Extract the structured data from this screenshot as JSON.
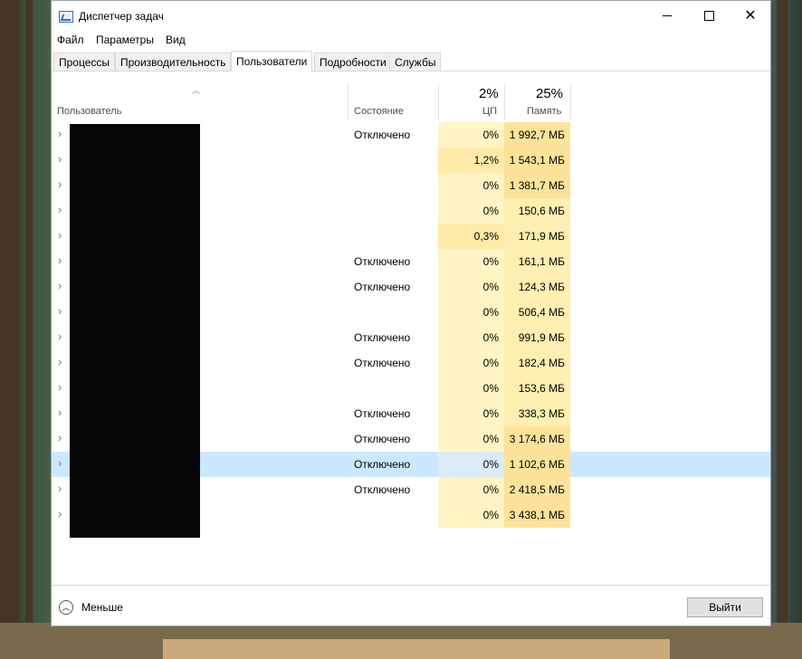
{
  "window": {
    "title": "Диспетчер задач",
    "minimize": "—",
    "maximize": "□",
    "close": "✕"
  },
  "menu": [
    "Файл",
    "Параметры",
    "Вид"
  ],
  "tabs": [
    "Процессы",
    "Производительность",
    "Пользователи",
    "Подробности",
    "Службы"
  ],
  "active_tab": "Пользователи",
  "columns": {
    "user": "Пользователь",
    "state": "Состояние",
    "cpu_total": "2%",
    "cpu": "ЦП",
    "mem_total": "25%",
    "mem": "Память"
  },
  "rows": [
    {
      "state": "Отключено",
      "cpu": "0%",
      "mem": "1 992,7 МБ"
    },
    {
      "state": "",
      "cpu": "1,2%",
      "mem": "1 543,1 МБ"
    },
    {
      "state": "",
      "cpu": "0%",
      "mem": "1 381,7 МБ"
    },
    {
      "state": "",
      "cpu": "0%",
      "mem": "150,6 МБ"
    },
    {
      "state": "",
      "cpu": "0,3%",
      "mem": "171,9 МБ"
    },
    {
      "state": "Отключено",
      "cpu": "0%",
      "mem": "161,1 МБ"
    },
    {
      "state": "Отключено",
      "cpu": "0%",
      "mem": "124,3 МБ"
    },
    {
      "state": "",
      "cpu": "0%",
      "mem": "506,4 МБ"
    },
    {
      "state": "Отключено",
      "cpu": "0%",
      "mem": "991,9 МБ"
    },
    {
      "state": "Отключено",
      "cpu": "0%",
      "mem": "182,4 МБ"
    },
    {
      "state": "",
      "cpu": "0%",
      "mem": "153,6 МБ"
    },
    {
      "state": "Отключено",
      "cpu": "0%",
      "mem": "338,3 МБ"
    },
    {
      "state": "Отключено",
      "cpu": "0%",
      "mem": "3 174,6 МБ"
    },
    {
      "state": "Отключено",
      "cpu": "0%",
      "mem": "1 102,6 МБ"
    },
    {
      "state": "Отключено",
      "cpu": "0%",
      "mem": "2 418,5 МБ"
    },
    {
      "state": "",
      "cpu": "0%",
      "mem": "3 438,1 МБ"
    }
  ],
  "selected_row": 13,
  "footer": {
    "fewer": "Меньше",
    "exit": "Выйти"
  },
  "colors": {
    "cpu_light": "#fff4c4",
    "cpu_medium": "#ffeaa8",
    "mem_light": "#ffefb0",
    "mem_medium": "#fde29a",
    "selected": "#cce8ff"
  }
}
